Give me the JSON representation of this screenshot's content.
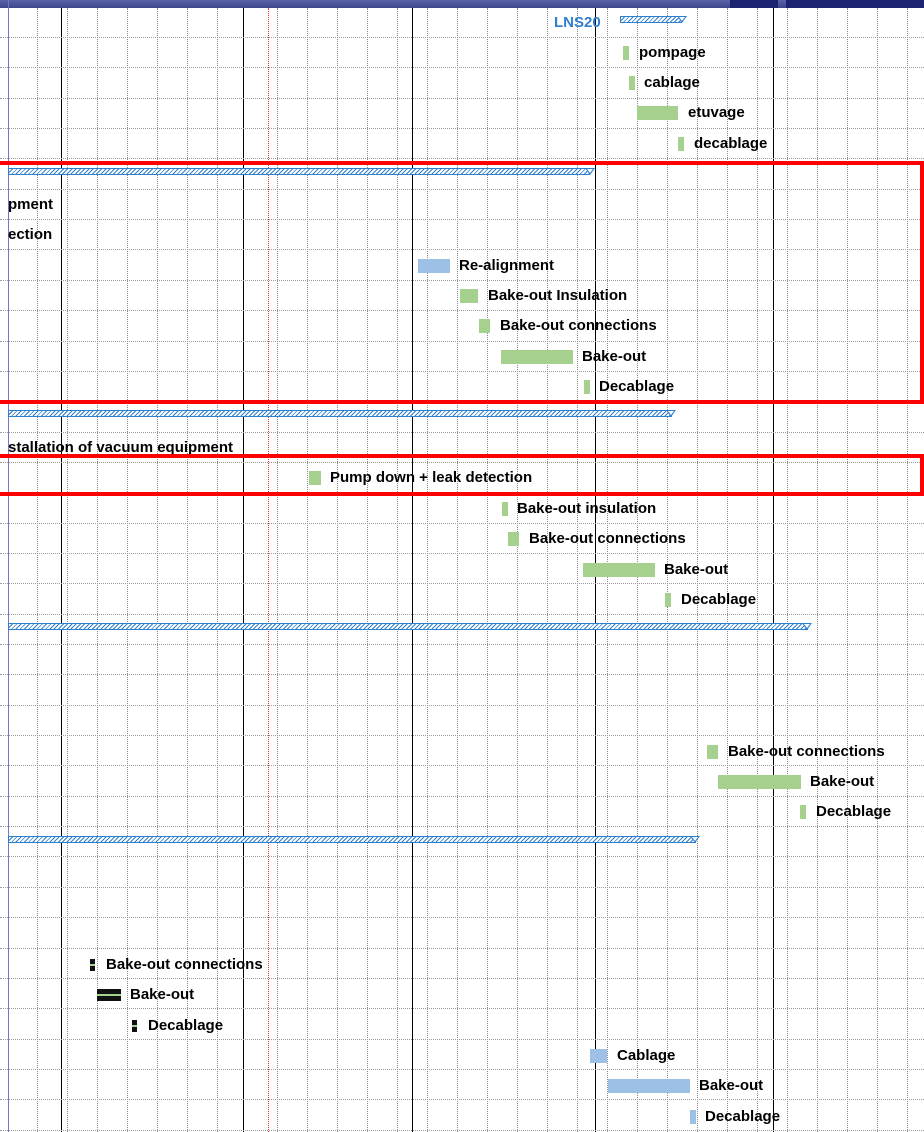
{
  "header": {
    "project_label": "LNS20"
  },
  "tasks": {
    "lns20_pompage": "pompage",
    "lns20_cablage": "cablage",
    "lns20_etuvage": "etuvage",
    "lns20_decablage": "decablage",
    "g1_partial_a": "pment",
    "g1_partial_b": "ection",
    "g1_realignment": "Re-alignment",
    "g1_bakeout_insulation": "Bake-out Insulation",
    "g1_bakeout_connections": "Bake-out connections",
    "g1_bakeout": "Bake-out",
    "g1_decablage": "Decablage",
    "g2_installation": "stallation of vacuum equipment",
    "g2_pumpdown": "Pump down + leak detection",
    "g2_bakeout_insulation": "Bake-out insulation",
    "g2_bakeout_connections": "Bake-out connections",
    "g2_bakeout": "Bake-out",
    "g2_decablage": "Decablage",
    "g3_bakeout_connections": "Bake-out connections",
    "g3_bakeout": "Bake-out",
    "g3_decablage": "Decablage",
    "g4_bakeout_connections": "Bake-out connections",
    "g4_bakeout": "Bake-out",
    "g4_decablage": "Decablage",
    "g5_cablage": "Cablage",
    "g5_bakeout": "Bake-out",
    "g5_decablage": "Decablage"
  },
  "colors": {
    "task_green": "#a6d08d",
    "task_blue": "#9dc1e6",
    "summary_blue": "#2f7fcf",
    "highlight_red": "#ff0000",
    "today_line": "#e03030"
  }
}
